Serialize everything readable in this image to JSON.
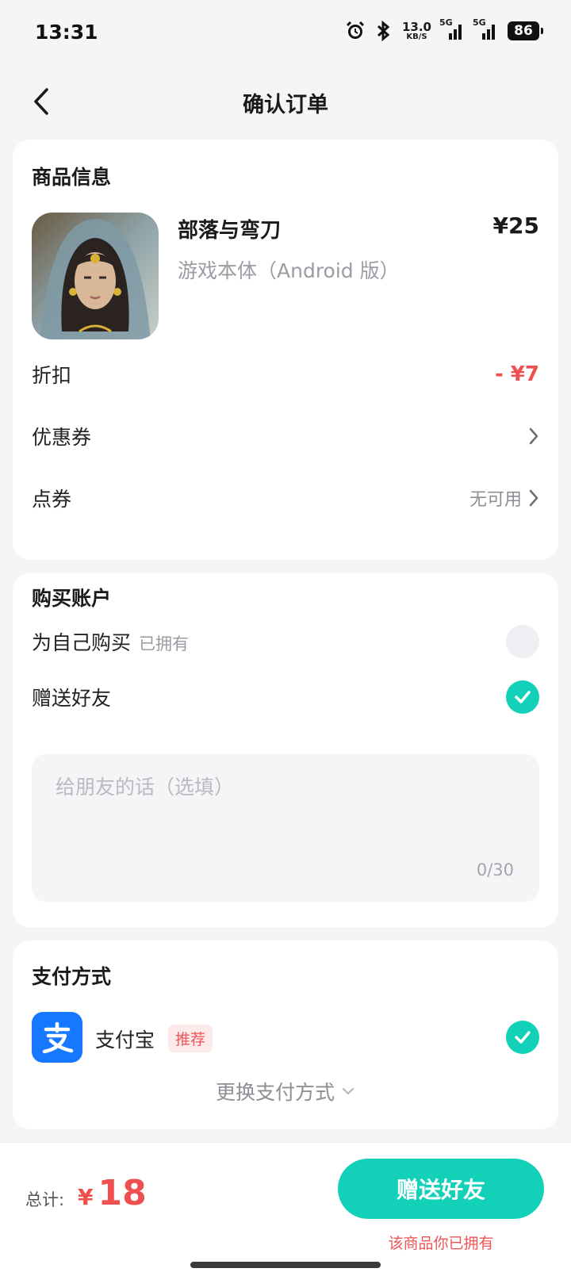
{
  "status_bar": {
    "time": "13:31",
    "net_speed": "13.0",
    "net_unit": "KB/S",
    "signal1": "5G",
    "signal2": "5G",
    "battery": "86",
    "icons": [
      "alarm-icon",
      "bluetooth-icon",
      "signal-icon",
      "signal-icon",
      "battery-icon"
    ]
  },
  "navbar": {
    "title": "确认订单"
  },
  "product": {
    "section_title": "商品信息",
    "name": "部落与弯刀",
    "edition": "游戏本体（Android 版）",
    "price": "¥25",
    "discount_label": "折扣",
    "discount_value": "- ¥7",
    "coupon_label": "优惠券",
    "points_label": "点券",
    "points_value": "无可用"
  },
  "account": {
    "section_title": "购买账户",
    "self_label": "为自己购买",
    "self_tag": "已拥有",
    "gift_label": "赠送好友",
    "message_placeholder": "给朋友的话（选填）",
    "message_counter": "0/30"
  },
  "payment": {
    "section_title": "支付方式",
    "method_name": "支付宝",
    "recommend_badge": "推荐",
    "change_label": "更换支付方式"
  },
  "footer": {
    "total_label": "总计:",
    "currency": "¥",
    "total_amount": "18",
    "button_label": "赠送好友",
    "owned_hint": "该商品你已拥有"
  },
  "colors": {
    "accent": "#12d1b8",
    "price_red": "#f04f4f",
    "alipay_blue": "#1677ff"
  }
}
